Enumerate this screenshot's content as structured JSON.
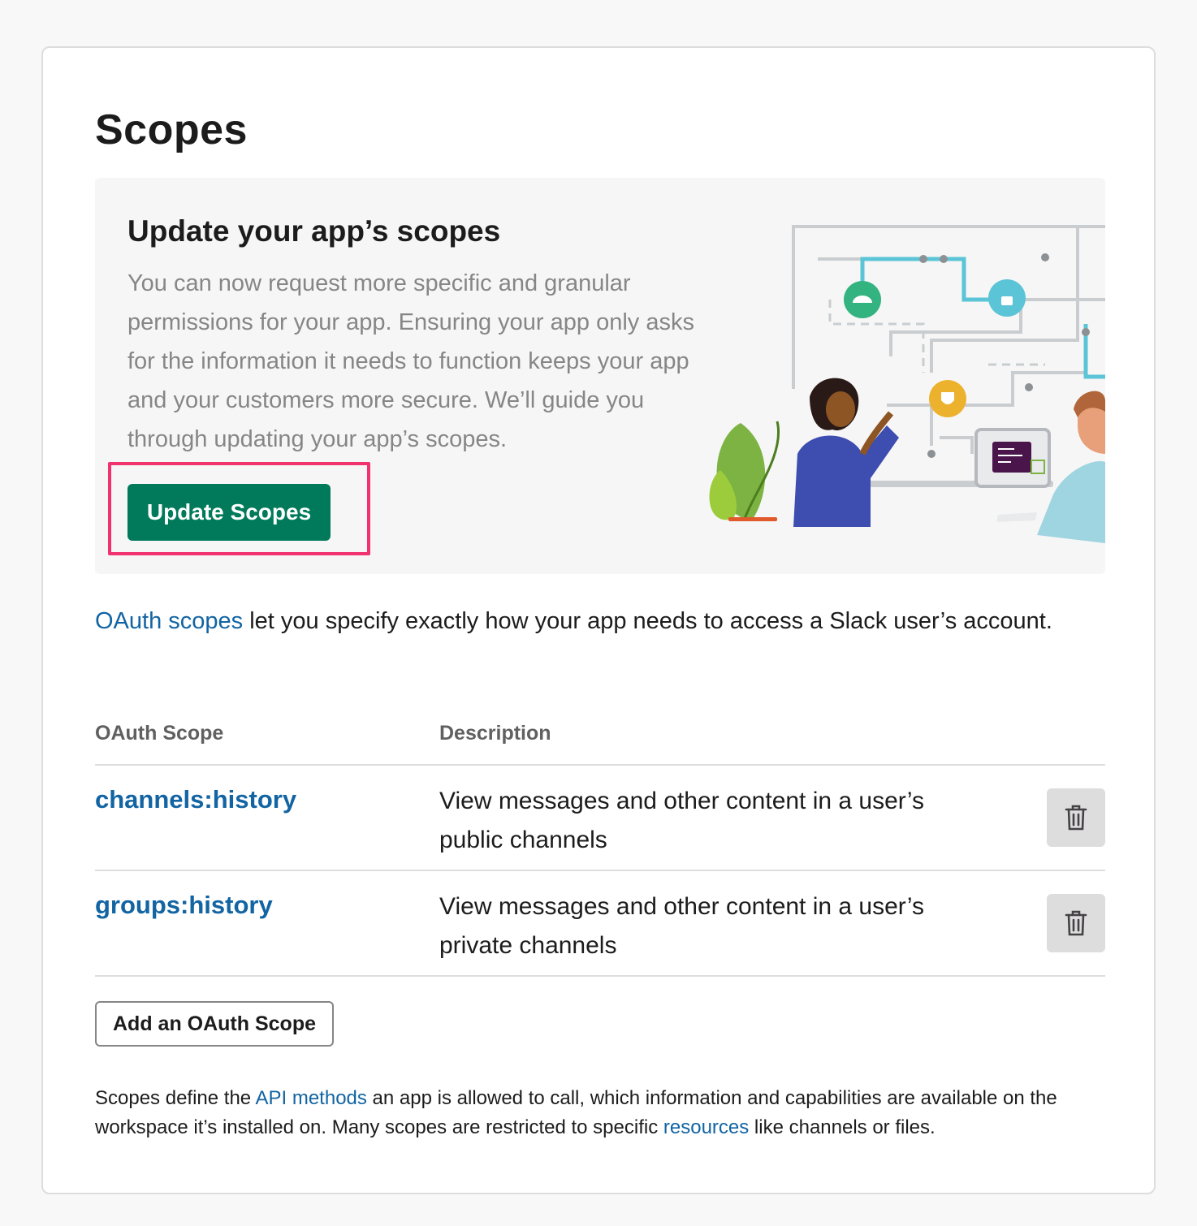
{
  "page": {
    "title": "Scopes"
  },
  "promo": {
    "title": "Update your app’s scopes",
    "text": "You can now request more specific and granular permissions for your app. Ensuring your app only asks for the information it needs to function keeps your app and your customers more secure. We’ll guide you through updating your app’s scopes.",
    "button_label": "Update Scopes"
  },
  "intro": {
    "link_text": "OAuth scopes",
    "rest_text": " let you specify exactly how your app needs to access a Slack user’s account."
  },
  "table": {
    "headers": [
      "OAuth Scope",
      "Description"
    ],
    "rows": [
      {
        "scope": "channels:history",
        "description": "View messages and other content in a user’s public channels"
      },
      {
        "scope": "groups:history",
        "description": "View messages and other content in a user’s private channels"
      }
    ]
  },
  "add_scope_label": "Add an OAuth Scope",
  "footnote": {
    "part1": "Scopes define the ",
    "link1": "API methods",
    "part2": " an app is allowed to call, which information and capabilities are available on the workspace it’s installed on. Many scopes are restricted to specific ",
    "link2": "resources",
    "part3": " like channels or files."
  },
  "colors": {
    "primary_button": "#007a5a",
    "link": "#1264a3",
    "highlight": "#f0326f"
  },
  "icons": {
    "delete": "trash-icon"
  }
}
